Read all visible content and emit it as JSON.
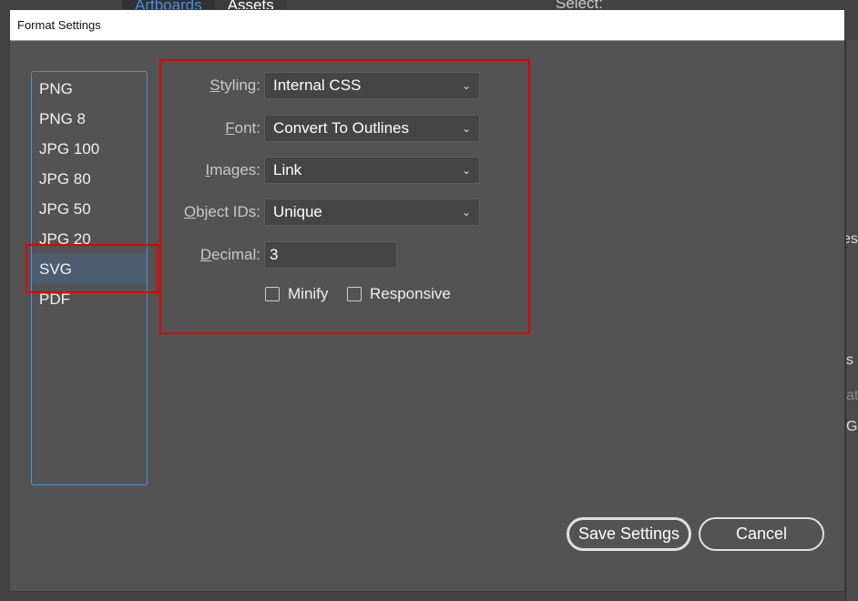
{
  "background": {
    "tabs": [
      "Artboards",
      "Assets"
    ],
    "select_label": "Select:",
    "right_fragments": [
      "es",
      "s",
      "at",
      "G"
    ]
  },
  "dialog": {
    "title": "Format Settings",
    "formats": [
      "PNG",
      "PNG 8",
      "JPG 100",
      "JPG 80",
      "JPG 50",
      "JPG 20",
      "SVG",
      "PDF"
    ],
    "selected_format": "SVG",
    "fields": {
      "styling": {
        "label_u": "S",
        "label_rest": "tyling:",
        "value": "Internal CSS"
      },
      "font": {
        "label_u": "F",
        "label_rest": "ont:",
        "value": "Convert To Outlines"
      },
      "images": {
        "label_u": "I",
        "label_rest": "mages:",
        "value": "Link"
      },
      "object_ids": {
        "label_u": "O",
        "label_rest": "bject IDs:",
        "value": "Unique"
      },
      "decimal": {
        "label_u": "D",
        "label_rest": "ecimal:",
        "value": "3"
      }
    },
    "checkboxes": {
      "minify": {
        "label": "Minify",
        "checked": false
      },
      "responsive": {
        "label": "Responsive",
        "checked": false
      }
    },
    "buttons": {
      "save": "Save Settings",
      "cancel": "Cancel"
    }
  },
  "colors": {
    "highlight": "#e00000",
    "selection": "#4d5d70",
    "list_border": "#4a90d9"
  }
}
